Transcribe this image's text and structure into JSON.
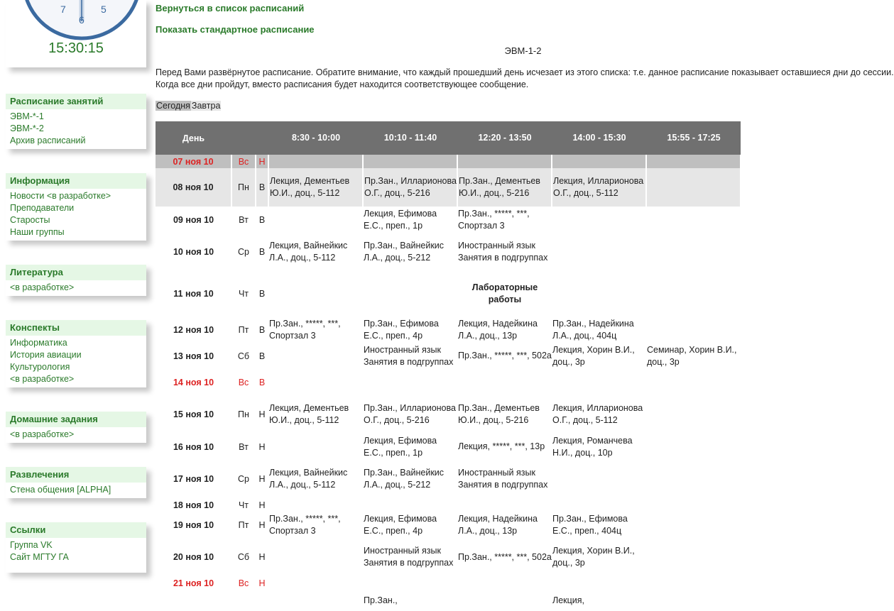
{
  "clock": {
    "time": "15:30:15",
    "digits": [
      "7",
      "6",
      "5"
    ]
  },
  "sidebar": [
    {
      "title": "Расписание занятий",
      "links": [
        "ЭВМ-*-1",
        "ЭВМ-*-2",
        "Архив расписаний"
      ]
    },
    {
      "title": "Информация",
      "links": [
        "Новости <в разработке>",
        "Преподаватели",
        "Старосты",
        "Наши группы"
      ]
    },
    {
      "title": "Литература",
      "links": [
        "<в разработке>"
      ]
    },
    {
      "title": "Конспекты",
      "links": [
        "Информатика",
        "История авиации",
        "Культурология",
        "<в разработке>"
      ]
    },
    {
      "title": "Домашние задания",
      "links": [
        "<в разработке>"
      ]
    },
    {
      "title": "Развлечения",
      "links": [
        "Стена общения [ALPHA]"
      ]
    },
    {
      "title": "Ссылки",
      "links": [
        "Группа VK",
        "Сайт МГТУ ГА"
      ]
    }
  ],
  "main": {
    "back_link": "Вернуться в список расписаний",
    "standard_link": "Показать стандартное расписание",
    "group_name": "ЭВМ-1-2",
    "note": "Перед Вами развёрнутое расписание. Обратите внимание, что каждый прошедший день исчезает из этого списка: т.е. данное расписание показывает оставшиеся дни до сессии. Когда все дни пройдут, вместо расписания будет находится соответствующее сообщение.",
    "tabs": [
      "Сегодня",
      "Завтра"
    ]
  },
  "schedule": {
    "headers": [
      "День",
      "",
      "",
      "8:30 - 10:00",
      "10:10 - 11:40",
      "12:20 - 13:50",
      "14:00 - 15:30",
      "15:55 - 17:25"
    ],
    "rows": [
      {
        "date": "07 ноя 10",
        "dow": "Вс",
        "week": "Н",
        "slots": [
          "",
          "",
          "",
          "",
          ""
        ]
      },
      {
        "date": "08 ноя 10",
        "dow": "Пн",
        "week": "В",
        "slots": [
          "Лекция, Дементьев Ю.И., доц., 5-112",
          "Пр.Зан., Илларионова О.Г., доц., 5-216",
          "Пр.Зан., Дементьев Ю.И., доц., 5-216",
          "Лекция, Илларионова О.Г., доц., 5-112",
          ""
        ]
      },
      {
        "date": "09 ноя 10",
        "dow": "Вт",
        "week": "В",
        "slots": [
          "",
          "Лекция, Ефимова Е.С., преп., 1р",
          "Пр.Зан., *****, ***, Спортзал 3",
          "",
          ""
        ]
      },
      {
        "date": "10 ноя 10",
        "dow": "Ср",
        "week": "В",
        "slots": [
          "Лекция, Вайнейкис Л.А., доц., 5-112",
          "Пр.Зан., Вайнейкис Л.А., доц., 5-212",
          "Иностранный язык Занятия в подгруппах",
          "",
          ""
        ]
      },
      {
        "date": "11 ноя 10",
        "dow": "Чт",
        "week": "В",
        "lab": "Лабораторные работы"
      },
      {
        "date": "12 ноя 10",
        "dow": "Пт",
        "week": "В",
        "slots": [
          "Пр.Зан., *****, ***, Спортзал 3",
          "Пр.Зан., Ефимова Е.С., преп., 4р",
          "Лекция, Надейкина Л.А., доц., 13р",
          "Пр.Зан., Надейкина Л.А., доц., 404ц",
          ""
        ]
      },
      {
        "date": "13 ноя 10",
        "dow": "Сб",
        "week": "В",
        "slots": [
          "",
          "Иностранный язык Занятия в подгруппах",
          "Пр.Зан., *****, ***, 502а",
          "Лекция, Хорин В.И., доц., 3р",
          "Семинар, Хорин В.И., доц., 3р"
        ]
      },
      {
        "date": "14 ноя 10",
        "dow": "Вс",
        "week": "В",
        "slots": [
          "",
          "",
          "",
          "",
          ""
        ]
      },
      {
        "date": "15 ноя 10",
        "dow": "Пн",
        "week": "Н",
        "slots": [
          "Лекция, Дементьев Ю.И., доц., 5-112",
          "Пр.Зан., Илларионова О.Г., доц., 5-216",
          "Пр.Зан., Дементьев Ю.И., доц., 5-216",
          "Лекция, Илларионова О.Г., доц., 5-112",
          ""
        ]
      },
      {
        "date": "16 ноя 10",
        "dow": "Вт",
        "week": "Н",
        "slots": [
          "",
          "Лекция, Ефимова Е.С., преп., 1р",
          "Лекция, *****, ***, 13р",
          "Лекция, Романчева Н.И., доц., 10р",
          ""
        ]
      },
      {
        "date": "17 ноя 10",
        "dow": "Ср",
        "week": "Н",
        "slots": [
          "Лекция, Вайнейкис Л.А., доц., 5-112",
          "Пр.Зан., Вайнейкис Л.А., доц., 5-212",
          "Иностранный язык Занятия в подгруппах",
          "",
          ""
        ]
      },
      {
        "date": "18 ноя 10",
        "dow": "Чт",
        "week": "Н",
        "slots": [
          "",
          "",
          "",
          "",
          ""
        ]
      },
      {
        "date": "19 ноя 10",
        "dow": "Пт",
        "week": "Н",
        "slots": [
          "Пр.Зан., *****, ***, Спортзал 3",
          "Лекция, Ефимова Е.С., преп., 4р",
          "Лекция, Надейкина Л.А., доц., 13р",
          "Пр.Зан., Ефимова Е.С., преп., 404ц",
          ""
        ]
      },
      {
        "date": "20 ноя 10",
        "dow": "Сб",
        "week": "Н",
        "slots": [
          "",
          "Иностранный язык Занятия в подгруппах",
          "Пр.Зан., *****, ***, 502а",
          "Лекция, Хорин В.И., доц., 3р",
          ""
        ]
      },
      {
        "date": "21 ноя 10",
        "dow": "Вс",
        "week": "Н",
        "slots": [
          "",
          "",
          "",
          "",
          ""
        ]
      },
      {
        "date": "",
        "dow": "",
        "week": "",
        "slots": [
          "",
          "Пр.Зан.,",
          "",
          "Лекция,",
          ""
        ]
      }
    ]
  },
  "colors": {
    "accent_green": "#2a7a2a",
    "panel_head_bg": "#e5f7e5",
    "header_bg": "#707070",
    "sunday_red": "#d22"
  }
}
